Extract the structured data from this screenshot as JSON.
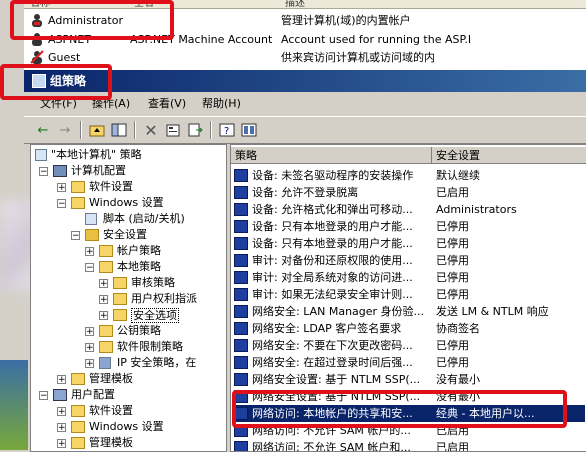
{
  "users": {
    "headers": [
      "名称",
      "全名",
      "描述"
    ],
    "rows": [
      {
        "name": "Administrator",
        "fullname": "",
        "desc": "管理计算机(域)的内置帐户"
      },
      {
        "name": "ASPNET",
        "fullname": "ASP.NET Machine Account",
        "desc": "Account used for running the ASP.I"
      },
      {
        "name": "Guest",
        "fullname": "",
        "desc": "供来宾访问计算机或访问域的内"
      }
    ]
  },
  "window": {
    "title": "组策略"
  },
  "menu": [
    "文件(F)",
    "操作(A)",
    "查看(V)",
    "帮助(H)"
  ],
  "tree": [
    {
      "label": "\"本地计算机\" 策略"
    },
    {
      "label": "计算机配置"
    },
    {
      "label": "软件设置"
    },
    {
      "label": "Windows 设置"
    },
    {
      "label": "脚本 (启动/关机)"
    },
    {
      "label": "安全设置"
    },
    {
      "label": "帐户策略"
    },
    {
      "label": "本地策略"
    },
    {
      "label": "审核策略"
    },
    {
      "label": "用户权利指派"
    },
    {
      "label": "安全选项"
    },
    {
      "label": "公钥策略"
    },
    {
      "label": "软件限制策略"
    },
    {
      "label": "IP 安全策略，在"
    },
    {
      "label": "管理模板"
    },
    {
      "label": "用户配置"
    },
    {
      "label": "软件设置"
    },
    {
      "label": "Windows 设置"
    },
    {
      "label": "管理模板"
    }
  ],
  "list": {
    "headers": [
      "策略",
      "安全设置"
    ],
    "rows": [
      {
        "policy": "设备: 未签名驱动程序的安装操作",
        "setting": "默认继续"
      },
      {
        "policy": "设备: 允许不登录脱离",
        "setting": "已启用"
      },
      {
        "policy": "设备: 允许格式化和弹出可移动...",
        "setting": "Administrators"
      },
      {
        "policy": "设备: 只有本地登录的用户才能...",
        "setting": "已停用"
      },
      {
        "policy": "设备: 只有本地登录的用户才能...",
        "setting": "已停用"
      },
      {
        "policy": "审计: 对备份和还原权限的使用...",
        "setting": "已停用"
      },
      {
        "policy": "审计: 对全局系统对象的访问进...",
        "setting": "已停用"
      },
      {
        "policy": "审计: 如果无法纪录安全审计则...",
        "setting": "已停用"
      },
      {
        "policy": "网络安全: LAN Manager 身份验...",
        "setting": "发送 LM & NTLM 响应"
      },
      {
        "policy": "网络安全: LDAP 客户签名要求",
        "setting": "协商签名"
      },
      {
        "policy": "网络安全: 不要在下次更改密码...",
        "setting": "已停用"
      },
      {
        "policy": "网络安全: 在超过登录时间后强...",
        "setting": "已停用"
      },
      {
        "policy": "网络安全设置: 基于 NTLM SSP(...",
        "setting": "没有最小"
      },
      {
        "policy": "网络安全设置: 基于 NTLM SSP(...",
        "setting": "没有最小"
      },
      {
        "policy": "网络访问: 本地帐户的共享和安...",
        "setting": "经典 - 本地用户以..."
      },
      {
        "policy": "网络访问: 不允许 SAM 帐户的...",
        "setting": "已启用"
      },
      {
        "policy": "网络访问: 不允许 SAM 帐户和...",
        "setting": "已启用"
      }
    ]
  },
  "colors": {
    "highlight": "#e0101a",
    "titlebar": "#0a246a",
    "selection": "#0a246a"
  }
}
